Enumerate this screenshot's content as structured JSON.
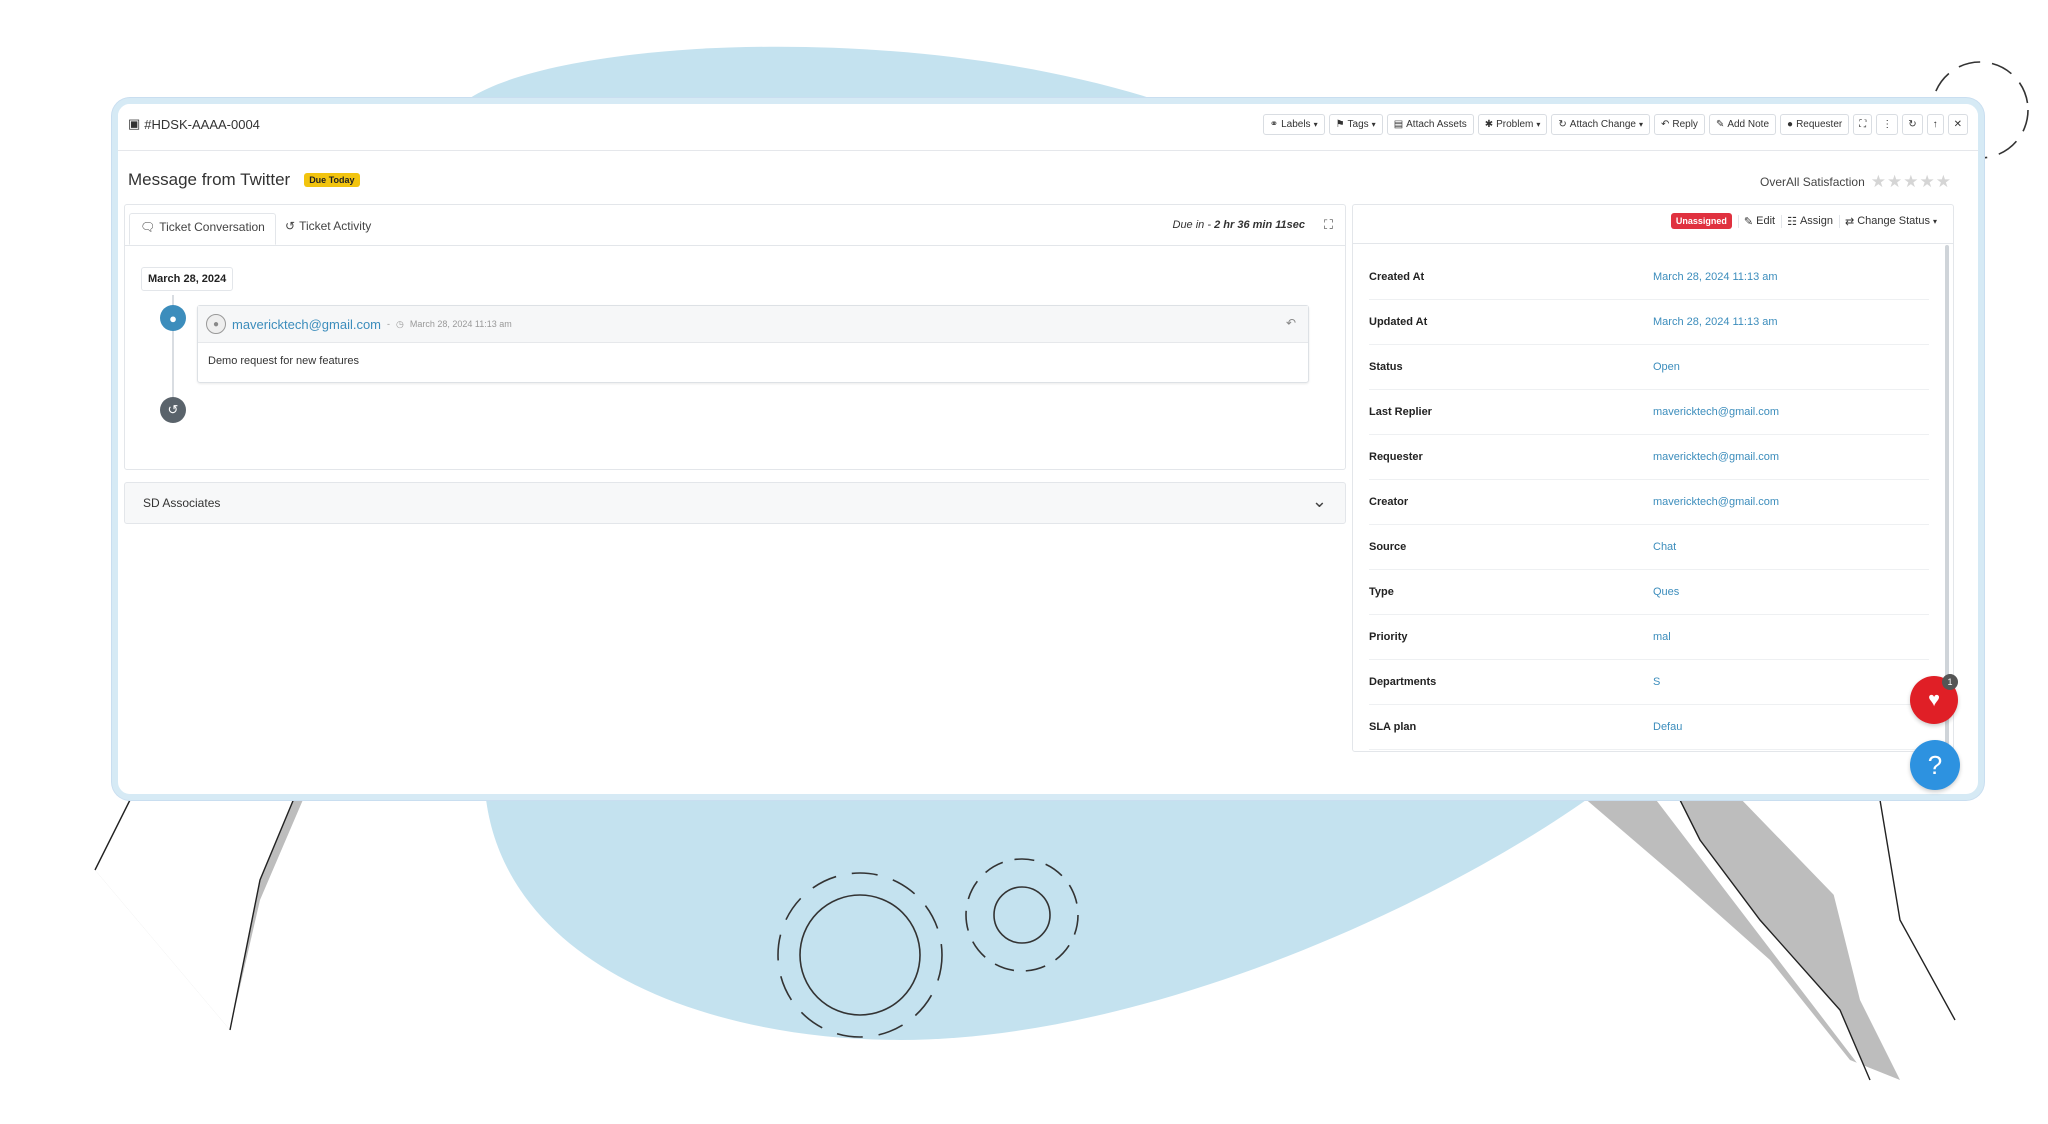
{
  "ticket": {
    "id": "#HDSK-AAAA-0004",
    "title": "Message from Twitter",
    "due_badge": "Due Today"
  },
  "toolbar": {
    "labels": "Labels",
    "tags": "Tags",
    "attach_assets": "Attach Assets",
    "problem": "Problem",
    "attach_change": "Attach Change",
    "reply": "Reply",
    "add_note": "Add Note",
    "requester": "Requester"
  },
  "satisfaction": {
    "label": "OverAll Satisfaction",
    "stars_filled": 0,
    "stars_total": 5
  },
  "tabs": [
    {
      "label": "Ticket Conversation",
      "active": true
    },
    {
      "label": "Ticket Activity",
      "active": false
    }
  ],
  "due_in": {
    "prefix": "Due in -",
    "value": "2 hr 36 min 11sec"
  },
  "conversation": {
    "date": "March 28, 2024",
    "message": {
      "email": "mavericktech@gmail.com",
      "separator": "-",
      "timestamp": "March 28, 2024 11:13 am",
      "body": "Demo request for new features"
    }
  },
  "associates": {
    "label": "SD Associates"
  },
  "details": {
    "status_badge": "Unassigned",
    "edit": "Edit",
    "assign": "Assign",
    "change_status": "Change Status",
    "rows": [
      {
        "label": "Created At",
        "value": "March 28, 2024 11:13 am"
      },
      {
        "label": "Updated At",
        "value": "March 28, 2024 11:13 am"
      },
      {
        "label": "Status",
        "value": "Open"
      },
      {
        "label": "Last Replier",
        "value": "mavericktech@gmail.com"
      },
      {
        "label": "Requester",
        "value": "mavericktech@gmail.com"
      },
      {
        "label": "Creator",
        "value": "mavericktech@gmail.com"
      },
      {
        "label": "Source",
        "value": "Chat"
      },
      {
        "label": "Type",
        "value": "Ques"
      },
      {
        "label": "Priority",
        "value": "mal"
      },
      {
        "label": "Departments",
        "value": "S"
      },
      {
        "label": "SLA plan",
        "value": "Defau"
      }
    ]
  },
  "floating": {
    "notification_count": "1",
    "help_symbol": "?"
  },
  "colors": {
    "accent_blue": "#3c8dbc",
    "blob_blue": "#c4e2ef",
    "danger_red": "#e0313f",
    "warning_yellow": "#f2c40f"
  }
}
